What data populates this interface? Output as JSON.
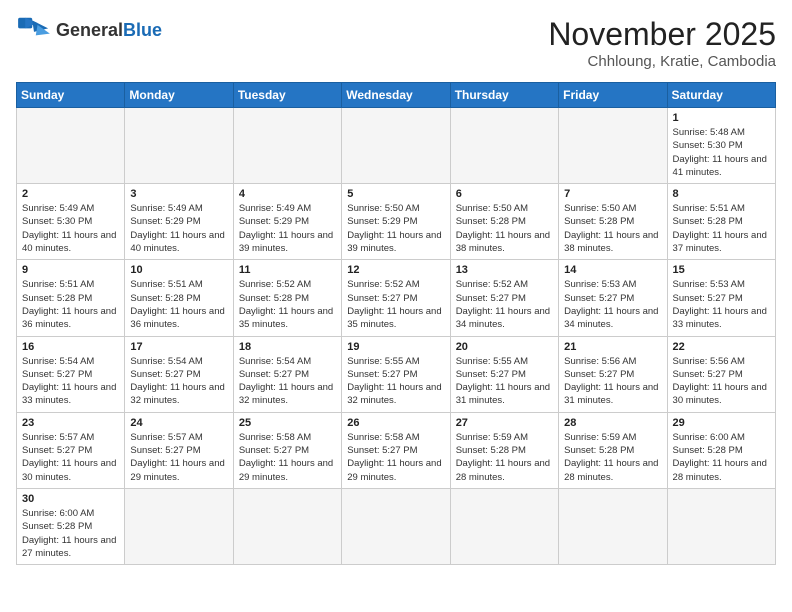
{
  "logo": {
    "text_general": "General",
    "text_blue": "Blue"
  },
  "header": {
    "month": "November 2025",
    "location": "Chhloung, Kratie, Cambodia"
  },
  "weekdays": [
    "Sunday",
    "Monday",
    "Tuesday",
    "Wednesday",
    "Thursday",
    "Friday",
    "Saturday"
  ],
  "days": [
    {
      "date": "",
      "empty": true
    },
    {
      "date": "",
      "empty": true
    },
    {
      "date": "",
      "empty": true
    },
    {
      "date": "",
      "empty": true
    },
    {
      "date": "",
      "empty": true
    },
    {
      "date": "",
      "empty": true
    },
    {
      "date": "1",
      "sunrise": "5:48 AM",
      "sunset": "5:30 PM",
      "daylight": "11 hours and 41 minutes."
    },
    {
      "date": "2",
      "sunrise": "5:49 AM",
      "sunset": "5:30 PM",
      "daylight": "11 hours and 40 minutes."
    },
    {
      "date": "3",
      "sunrise": "5:49 AM",
      "sunset": "5:29 PM",
      "daylight": "11 hours and 40 minutes."
    },
    {
      "date": "4",
      "sunrise": "5:49 AM",
      "sunset": "5:29 PM",
      "daylight": "11 hours and 39 minutes."
    },
    {
      "date": "5",
      "sunrise": "5:50 AM",
      "sunset": "5:29 PM",
      "daylight": "11 hours and 39 minutes."
    },
    {
      "date": "6",
      "sunrise": "5:50 AM",
      "sunset": "5:28 PM",
      "daylight": "11 hours and 38 minutes."
    },
    {
      "date": "7",
      "sunrise": "5:50 AM",
      "sunset": "5:28 PM",
      "daylight": "11 hours and 38 minutes."
    },
    {
      "date": "8",
      "sunrise": "5:51 AM",
      "sunset": "5:28 PM",
      "daylight": "11 hours and 37 minutes."
    },
    {
      "date": "9",
      "sunrise": "5:51 AM",
      "sunset": "5:28 PM",
      "daylight": "11 hours and 36 minutes."
    },
    {
      "date": "10",
      "sunrise": "5:51 AM",
      "sunset": "5:28 PM",
      "daylight": "11 hours and 36 minutes."
    },
    {
      "date": "11",
      "sunrise": "5:52 AM",
      "sunset": "5:28 PM",
      "daylight": "11 hours and 35 minutes."
    },
    {
      "date": "12",
      "sunrise": "5:52 AM",
      "sunset": "5:27 PM",
      "daylight": "11 hours and 35 minutes."
    },
    {
      "date": "13",
      "sunrise": "5:52 AM",
      "sunset": "5:27 PM",
      "daylight": "11 hours and 34 minutes."
    },
    {
      "date": "14",
      "sunrise": "5:53 AM",
      "sunset": "5:27 PM",
      "daylight": "11 hours and 34 minutes."
    },
    {
      "date": "15",
      "sunrise": "5:53 AM",
      "sunset": "5:27 PM",
      "daylight": "11 hours and 33 minutes."
    },
    {
      "date": "16",
      "sunrise": "5:54 AM",
      "sunset": "5:27 PM",
      "daylight": "11 hours and 33 minutes."
    },
    {
      "date": "17",
      "sunrise": "5:54 AM",
      "sunset": "5:27 PM",
      "daylight": "11 hours and 32 minutes."
    },
    {
      "date": "18",
      "sunrise": "5:54 AM",
      "sunset": "5:27 PM",
      "daylight": "11 hours and 32 minutes."
    },
    {
      "date": "19",
      "sunrise": "5:55 AM",
      "sunset": "5:27 PM",
      "daylight": "11 hours and 32 minutes."
    },
    {
      "date": "20",
      "sunrise": "5:55 AM",
      "sunset": "5:27 PM",
      "daylight": "11 hours and 31 minutes."
    },
    {
      "date": "21",
      "sunrise": "5:56 AM",
      "sunset": "5:27 PM",
      "daylight": "11 hours and 31 minutes."
    },
    {
      "date": "22",
      "sunrise": "5:56 AM",
      "sunset": "5:27 PM",
      "daylight": "11 hours and 30 minutes."
    },
    {
      "date": "23",
      "sunrise": "5:57 AM",
      "sunset": "5:27 PM",
      "daylight": "11 hours and 30 minutes."
    },
    {
      "date": "24",
      "sunrise": "5:57 AM",
      "sunset": "5:27 PM",
      "daylight": "11 hours and 29 minutes."
    },
    {
      "date": "25",
      "sunrise": "5:58 AM",
      "sunset": "5:27 PM",
      "daylight": "11 hours and 29 minutes."
    },
    {
      "date": "26",
      "sunrise": "5:58 AM",
      "sunset": "5:27 PM",
      "daylight": "11 hours and 29 minutes."
    },
    {
      "date": "27",
      "sunrise": "5:59 AM",
      "sunset": "5:28 PM",
      "daylight": "11 hours and 28 minutes."
    },
    {
      "date": "28",
      "sunrise": "5:59 AM",
      "sunset": "5:28 PM",
      "daylight": "11 hours and 28 minutes."
    },
    {
      "date": "29",
      "sunrise": "6:00 AM",
      "sunset": "5:28 PM",
      "daylight": "11 hours and 28 minutes."
    },
    {
      "date": "30",
      "sunrise": "6:00 AM",
      "sunset": "5:28 PM",
      "daylight": "11 hours and 27 minutes."
    },
    {
      "date": "",
      "empty": true
    },
    {
      "date": "",
      "empty": true
    },
    {
      "date": "",
      "empty": true
    },
    {
      "date": "",
      "empty": true
    },
    {
      "date": "",
      "empty": true
    },
    {
      "date": "",
      "empty": true
    }
  ]
}
